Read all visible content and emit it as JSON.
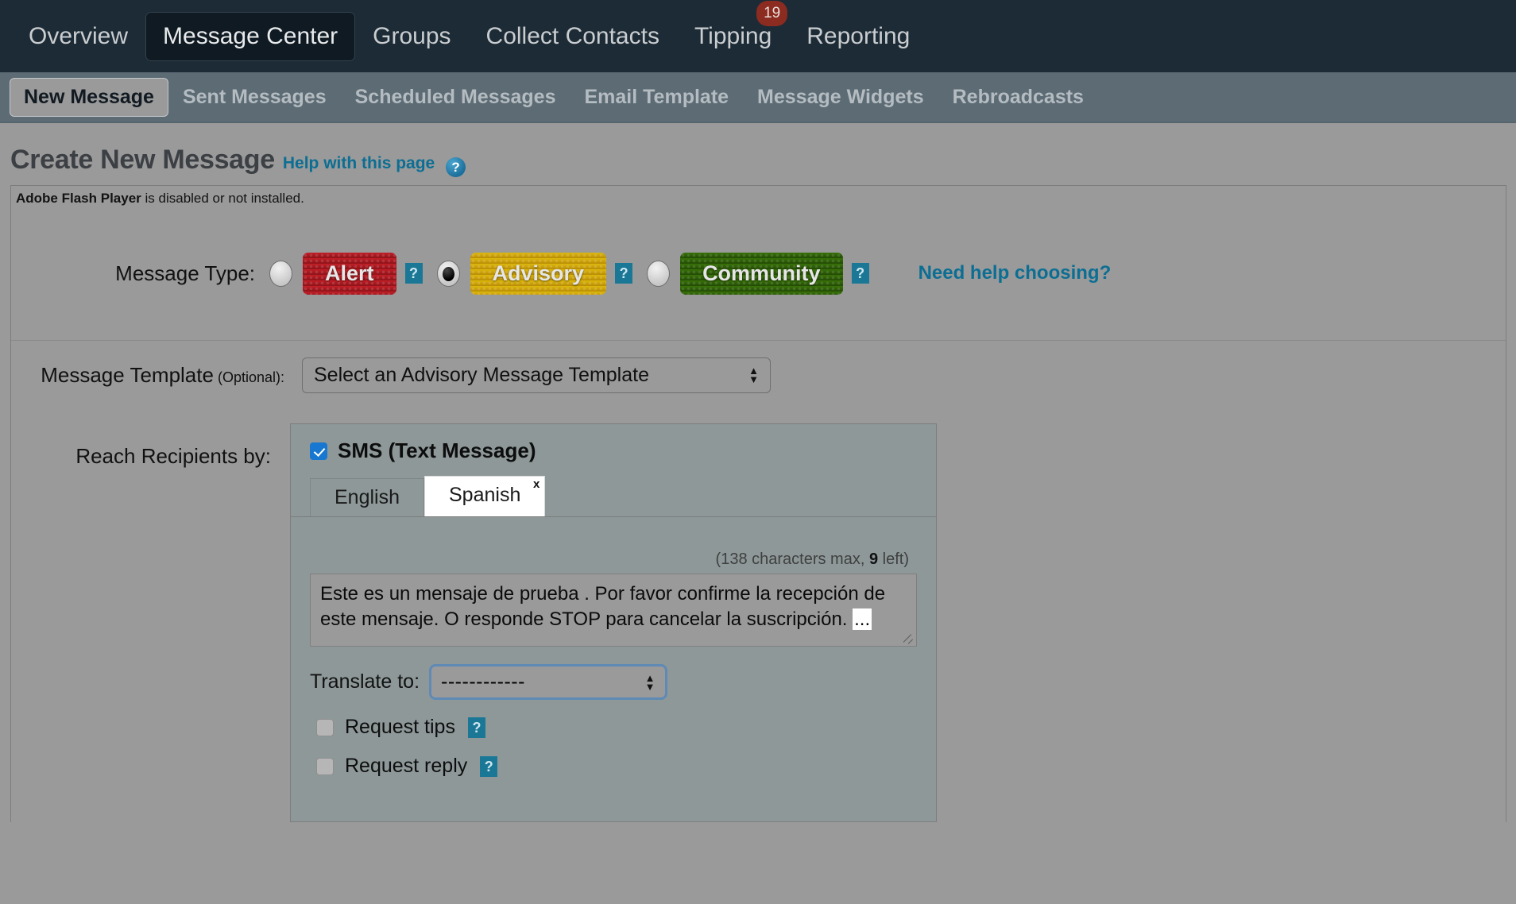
{
  "top_nav": {
    "items": [
      {
        "label": "Overview",
        "active": false
      },
      {
        "label": "Message Center",
        "active": true
      },
      {
        "label": "Groups",
        "active": false
      },
      {
        "label": "Collect Contacts",
        "active": false
      },
      {
        "label": "Tipping",
        "active": false,
        "badge": "19"
      },
      {
        "label": "Reporting",
        "active": false
      }
    ]
  },
  "sub_nav": {
    "items": [
      {
        "label": "New Message",
        "active": true
      },
      {
        "label": "Sent Messages",
        "active": false
      },
      {
        "label": "Scheduled Messages",
        "active": false
      },
      {
        "label": "Email Template",
        "active": false
      },
      {
        "label": "Message Widgets",
        "active": false
      },
      {
        "label": "Rebroadcasts",
        "active": false
      }
    ]
  },
  "page": {
    "title": "Create New Message",
    "help_link": "Help with this page",
    "help_icon_glyph": "?"
  },
  "flash_notice": {
    "bold": "Adobe Flash Player",
    "rest": " is disabled or not installed."
  },
  "message_type": {
    "label": "Message Type:",
    "options": [
      {
        "label": "Alert",
        "selected": false,
        "color": "#ab1a22"
      },
      {
        "label": "Advisory",
        "selected": true,
        "color": "#cfa70a"
      },
      {
        "label": "Community",
        "selected": false,
        "color": "#2e6007"
      }
    ],
    "help_glyph": "?",
    "need_help_link": "Need help choosing?"
  },
  "message_template": {
    "label": "Message Template",
    "optional": " (Optional):",
    "selected_value": "Select an Advisory Message Template"
  },
  "reach_recipients": {
    "label": "Reach Recipients by:",
    "sms": {
      "checkbox_checked": true,
      "title": "SMS (Text Message)",
      "tabs": [
        {
          "label": "English",
          "active": false,
          "closable": false
        },
        {
          "label": "Spanish",
          "active": true,
          "closable": true,
          "close_glyph": "x"
        }
      ],
      "char_count_prefix": "(138 characters max, ",
      "char_count_value": "9",
      "char_count_suffix": " left)",
      "message_text": "Este es un mensaje de prueba . Por favor confirme la recepción de este mensaje. O responde STOP para cancelar la suscripción.",
      "message_text_selected": "...",
      "translate_label": "Translate to:",
      "translate_value": "------------",
      "options": [
        {
          "label": "Request tips",
          "checked": false,
          "help_glyph": "?"
        },
        {
          "label": "Request reply",
          "checked": false,
          "help_glyph": "?"
        }
      ]
    }
  },
  "colors": {
    "top_nav_bg": "#1d2b36",
    "sub_nav_bg": "#5c6b74",
    "page_bg": "#9a9a9a",
    "link": "#0c6e93",
    "badge": "#8c2b20",
    "help_icon": "#1a7896",
    "checkbox_checked": "#1777d1",
    "focus_ring": "#5f8ab5"
  }
}
